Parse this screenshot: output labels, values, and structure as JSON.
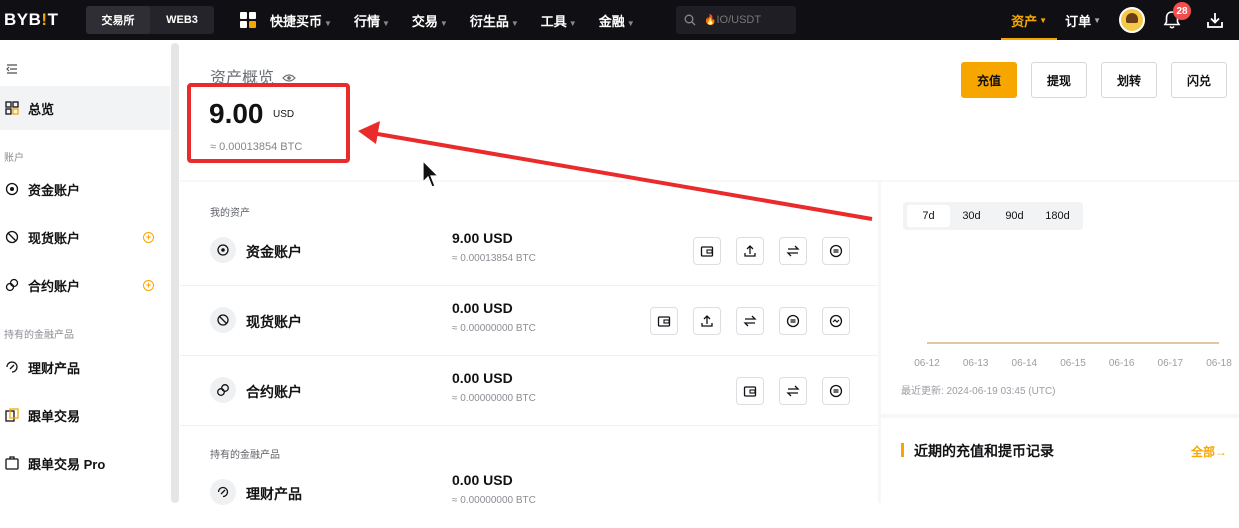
{
  "topbar": {
    "logo_main": "BYB",
    "logo_accent": "!",
    "logo_end": "T",
    "segments": [
      "交易所",
      "WEB3"
    ],
    "nav": [
      "快捷买币",
      "行情",
      "交易",
      "衍生品",
      "工具",
      "金融"
    ],
    "search_placeholder": "IO/USDT",
    "right_nav": [
      "资产",
      "订单"
    ],
    "notification_count": "28"
  },
  "sidebar": {
    "overview": "总览",
    "group_accounts": "账户",
    "accounts": [
      "资金账户",
      "现货账户",
      "合约账户"
    ],
    "group_products": "持有的金融产品",
    "products": [
      "理财产品",
      "跟单交易",
      "跟单交易 Pro"
    ]
  },
  "overview": {
    "title": "资产概览",
    "total": "9.00",
    "currency": "USD",
    "btc": "≈ 0.00013854 BTC",
    "buttons": [
      "充值",
      "提现",
      "划转",
      "闪兑"
    ]
  },
  "assets": {
    "my_assets_label": "我的资产",
    "rows": [
      {
        "name": "资金账户",
        "amount": "9.00 USD",
        "btc": "≈ 0.00013854 BTC"
      },
      {
        "name": "现货账户",
        "amount": "0.00 USD",
        "btc": "≈ 0.00000000 BTC"
      },
      {
        "name": "合约账户",
        "amount": "0.00 USD",
        "btc": "≈ 0.00000000 BTC"
      }
    ],
    "products_label": "持有的金融产品",
    "product_row": {
      "name": "理财产品",
      "amount": "0.00 USD",
      "btc": "≈ 0.00000000 BTC"
    }
  },
  "chart": {
    "ranges": [
      "7d",
      "30d",
      "90d",
      "180d"
    ],
    "active_range": "7d",
    "updated": "最近更新: 2024-06-19 03:45 (UTC)"
  },
  "chart_data": {
    "type": "line",
    "categories": [
      "06-12",
      "06-13",
      "06-14",
      "06-15",
      "06-16",
      "06-17",
      "06-18"
    ],
    "series": [
      {
        "values": [
          9,
          9,
          9,
          9,
          9,
          9,
          9
        ]
      }
    ],
    "title": "",
    "xlabel": "",
    "ylabel": ""
  },
  "records": {
    "title": "近期的充值和提币记录",
    "all": "全部"
  },
  "colors": {
    "accent": "#f7a600",
    "annotation": "#ea2b2b",
    "topbar": "#101014"
  }
}
